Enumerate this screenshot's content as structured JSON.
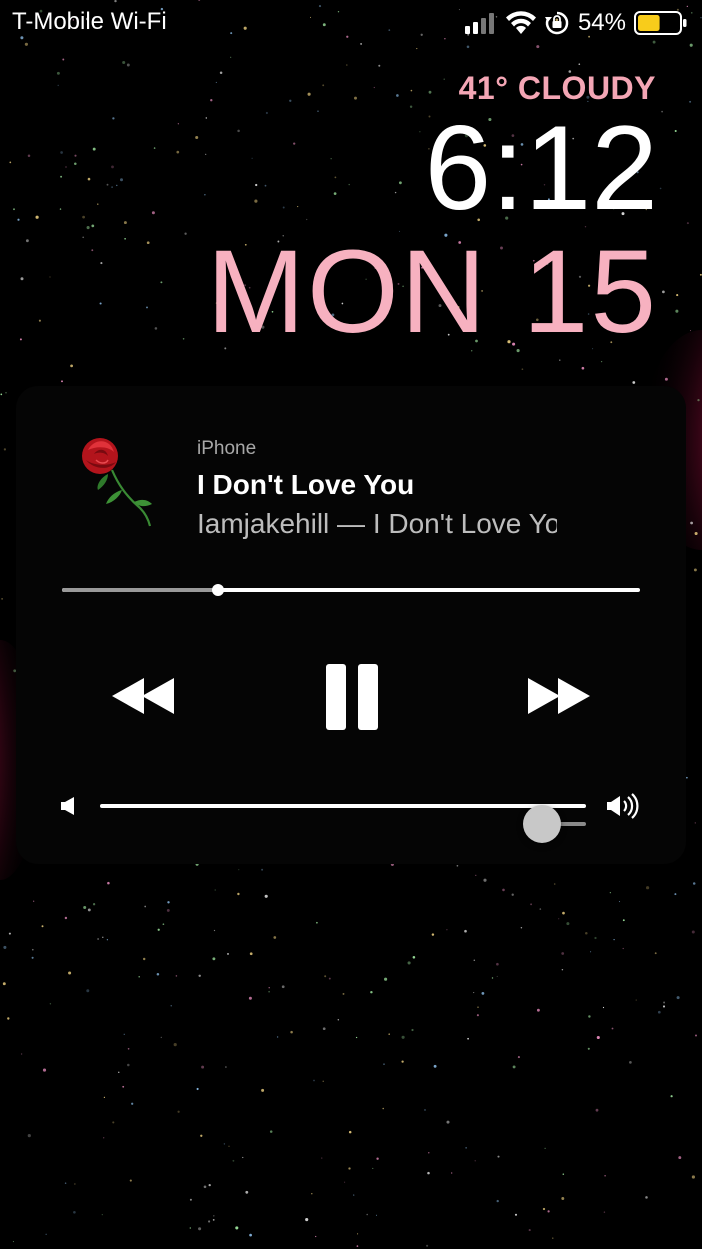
{
  "status_bar": {
    "carrier": "T-Mobile Wi-Fi",
    "battery_percent": "54%",
    "battery_level": 0.54
  },
  "lock_screen": {
    "weather": "41° CLOUDY",
    "time": "6:12",
    "date": "MON 15"
  },
  "now_playing": {
    "source": "iPhone",
    "title": "I Don't Love You",
    "subtitle": "Iamjakehill — I Don't Love You",
    "progress": 0.27,
    "volume": 0.91
  },
  "colors": {
    "accent_pink": "#f7b1c0",
    "battery_yellow": "#f8cc1b"
  },
  "icons": [
    "signal-icon",
    "wifi-icon",
    "rotation-lock-icon",
    "battery-icon",
    "rose-artwork",
    "rewind-icon",
    "pause-icon",
    "fast-forward-icon",
    "volume-low-icon",
    "volume-high-icon"
  ]
}
